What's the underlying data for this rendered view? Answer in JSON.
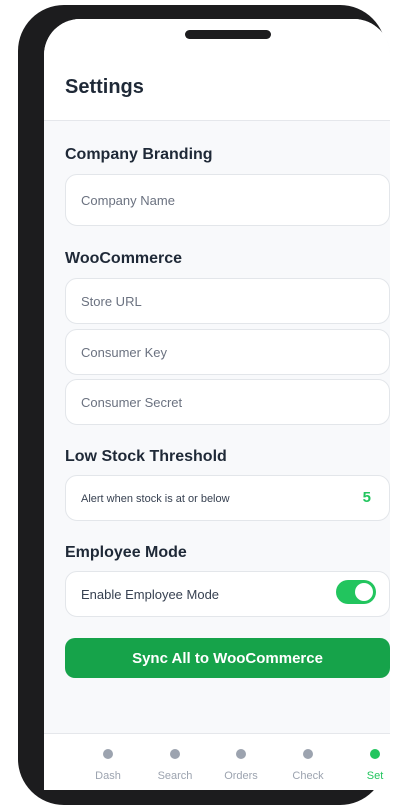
{
  "header": {
    "title": "Settings"
  },
  "branding": {
    "title": "Company Branding",
    "company_name_placeholder": "Company Name"
  },
  "woocommerce": {
    "title": "WooCommerce",
    "store_url_placeholder": "Store URL",
    "consumer_key_placeholder": "Consumer Key",
    "consumer_secret_placeholder": "Consumer Secret"
  },
  "low_stock": {
    "title": "Low Stock Threshold",
    "label": "Alert when stock is at or below",
    "value": "5"
  },
  "employee_mode": {
    "title": "Employee Mode",
    "label": "Enable Employee Mode",
    "enabled": true
  },
  "sync_button": {
    "label": "Sync All to WooCommerce"
  },
  "tabbar": {
    "items": [
      {
        "label": "Dash",
        "icon": "dot-icon"
      },
      {
        "label": "Search",
        "icon": "dot-icon"
      },
      {
        "label": "Orders",
        "icon": "dot-icon"
      },
      {
        "label": "Check",
        "icon": "dot-icon"
      },
      {
        "label": "Set",
        "icon": "dot-icon",
        "active": true
      }
    ]
  },
  "colors": {
    "accent": "#22c55e",
    "button": "#16a34a",
    "inactive": "#9ca3af",
    "text": "#1f2937"
  }
}
